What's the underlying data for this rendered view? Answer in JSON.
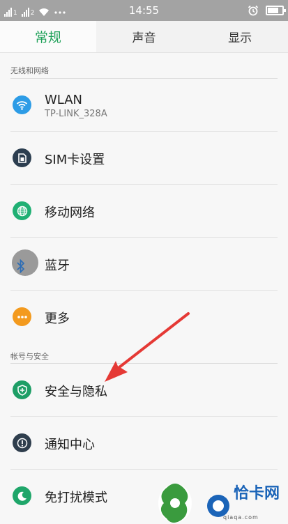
{
  "status_bar": {
    "time": "14:55",
    "sim1_label": "1",
    "sim2_label": "2"
  },
  "tabs": [
    {
      "label": "常规",
      "active": true
    },
    {
      "label": "声音",
      "active": false
    },
    {
      "label": "显示",
      "active": false
    }
  ],
  "sections": {
    "wireless": {
      "label": "无线和网络"
    },
    "account": {
      "label": "帐号与安全"
    }
  },
  "rows": {
    "wlan": {
      "title": "WLAN",
      "subtitle": "TP-LINK_328A",
      "icon": "wifi-icon"
    },
    "sim": {
      "title": "SIM卡设置",
      "icon": "sim-card-icon"
    },
    "mobile": {
      "title": "移动网络",
      "icon": "globe-icon"
    },
    "bluetooth": {
      "title": "蓝牙",
      "icon": "bluetooth-icon"
    },
    "more": {
      "title": "更多",
      "icon": "more-dots-icon"
    },
    "privacy": {
      "title": "安全与隐私",
      "icon": "shield-icon"
    },
    "notify": {
      "title": "通知中心",
      "icon": "alert-icon"
    },
    "dnd": {
      "title": "免打扰模式",
      "icon": "moon-icon"
    }
  },
  "watermark": {
    "name": "恰卡网",
    "url": "qiaqa.com"
  },
  "colors": {
    "accent": "#20a15a",
    "status_bar": "#a3a3a3",
    "background": "#f7f7f7",
    "arrow": "#e53935"
  }
}
